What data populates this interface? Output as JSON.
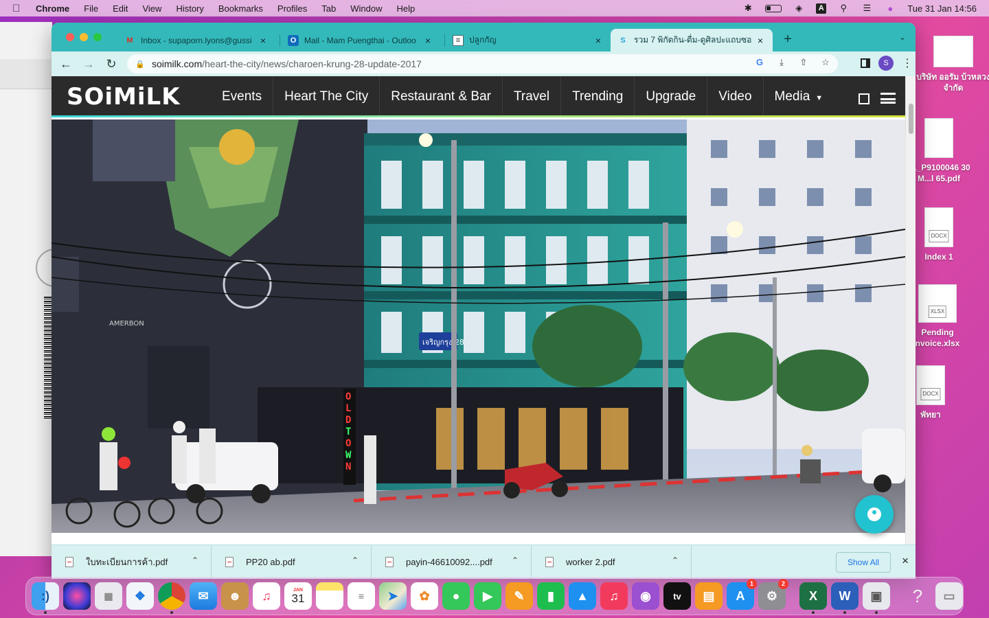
{
  "menubar": {
    "apple": "",
    "items": [
      "Chrome",
      "File",
      "Edit",
      "View",
      "History",
      "Bookmarks",
      "Profiles",
      "Tab",
      "Window",
      "Help"
    ],
    "ime_indicator": "A",
    "datetime": "Tue 31 Jan  14:56"
  },
  "browser": {
    "tabs": [
      {
        "icon": "gmail-icon",
        "title": "Inbox - supaporn.lyons@gussi"
      },
      {
        "icon": "outlook-icon",
        "title": "Mail - Mam Puengthai - Outloo"
      },
      {
        "icon": "document-icon",
        "title": "ปลูกกัญ"
      },
      {
        "icon": "soimilk-icon",
        "title": "รวม 7 พิกัดกิน-ดื่ม-ดูศิลปะแถบซอย"
      }
    ],
    "url_host": "soimilk.com",
    "url_path": "/heart-the-city/news/charoen-krung-28-update-2017",
    "profile_initial": "S"
  },
  "site": {
    "logo": "SOiMiLK",
    "nav": [
      "Events",
      "Heart The City",
      "Restaurant & Bar",
      "Travel",
      "Trending",
      "Upgrade",
      "Video",
      "Media"
    ],
    "street_sign": "เจริญกรุง 28",
    "neon_sign": "OLD TOWN"
  },
  "downloads": {
    "items": [
      "ใบทะเบียนการค้า.pdf",
      "PP20 ab.pdf",
      "payin-46610092....pdf",
      "worker 2.pdf"
    ],
    "show_all": "Show All"
  },
  "desktop": {
    "files": [
      {
        "label": "บริษัท ออรัม บ้วหลวง จำกัด",
        "type": "pdf"
      },
      {
        "label": "91_P9100046 30 M...l 65.pdf",
        "type": "pdf"
      },
      {
        "label": "Index 1",
        "type": "DOCX"
      },
      {
        "label": "Pending nvoice.xlsx",
        "type": "XLSX"
      },
      {
        "label": "พัทยา",
        "type": "DOCX"
      }
    ]
  },
  "dock": {
    "calendar_month": "JAN",
    "calendar_day": "31",
    "appstore_badge": "1",
    "settings_badge": "2",
    "appletv_label": "tv"
  },
  "colors": {
    "tabstrip": "#34b9bb",
    "toolbar": "#d8f1f1",
    "site_nav": "#2b2b2b",
    "accent_line": "#c7d63e",
    "chat_button": "#22c3d0"
  }
}
